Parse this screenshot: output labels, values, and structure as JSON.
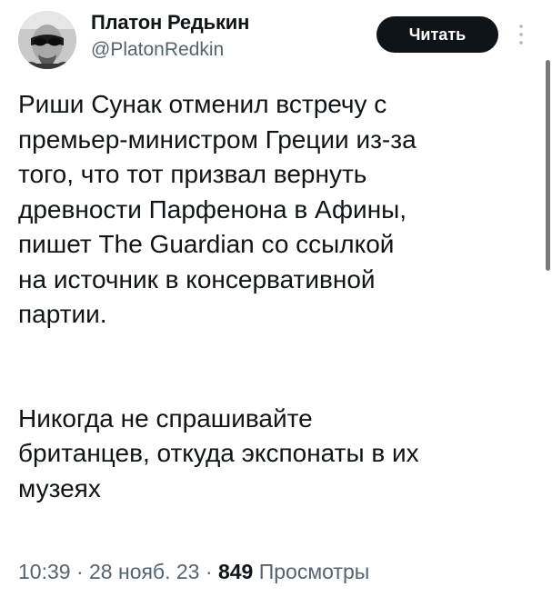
{
  "author": {
    "display_name": "Платон Редькин",
    "handle": "@PlatonRedkin",
    "avatar_icon": "profile-photo-sunglasses"
  },
  "follow_button": {
    "label": "Читать"
  },
  "more_icon": "more-vertical-icon",
  "tweet": {
    "paragraph_1_lines": [
      "Риши Сунак отменил встречу с",
      "премьер-министром Греции из-за",
      "того, что тот призвал вернуть",
      "древности Парфенона в Афины,",
      "пишет The Guardian со ссылкой",
      "на источник в консервативной",
      "партии."
    ],
    "paragraph_2_lines": [
      "Никогда не спрашивайте",
      "британцев, откуда экспонаты в их",
      "музеях"
    ]
  },
  "meta": {
    "time": "10:39",
    "date": "28 нояб. 23",
    "separator": "·",
    "views_count": "849",
    "views_label": "Просмотры"
  }
}
